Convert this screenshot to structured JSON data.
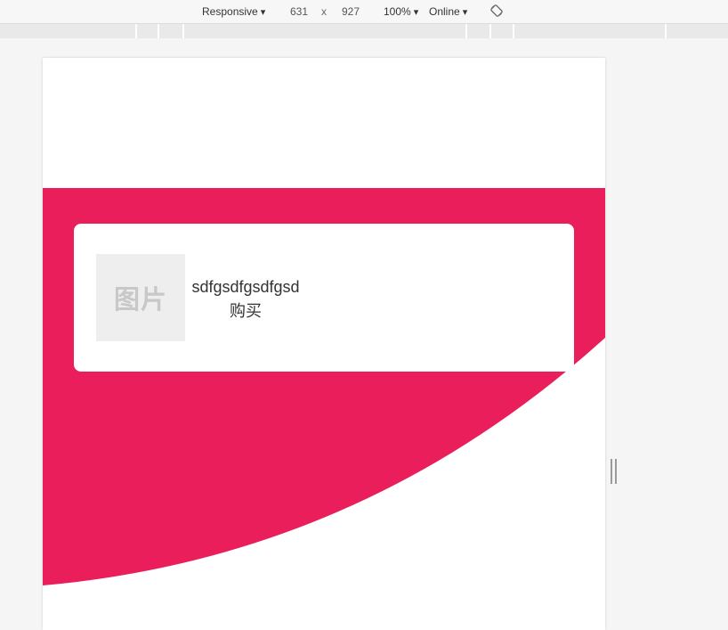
{
  "toolbar": {
    "device": "Responsive",
    "width": "631",
    "times": "x",
    "height": "927",
    "zoom": "100%",
    "network": "Online",
    "rotate_icon": "rotate-icon"
  },
  "colors": {
    "accent": "#e91e5b",
    "card": "#ffffff",
    "placeholder_bg": "#eeeeee"
  },
  "product": {
    "image_label": "图片",
    "title": "sdfgsdfgsdfgsd",
    "buy_label": "购买"
  }
}
